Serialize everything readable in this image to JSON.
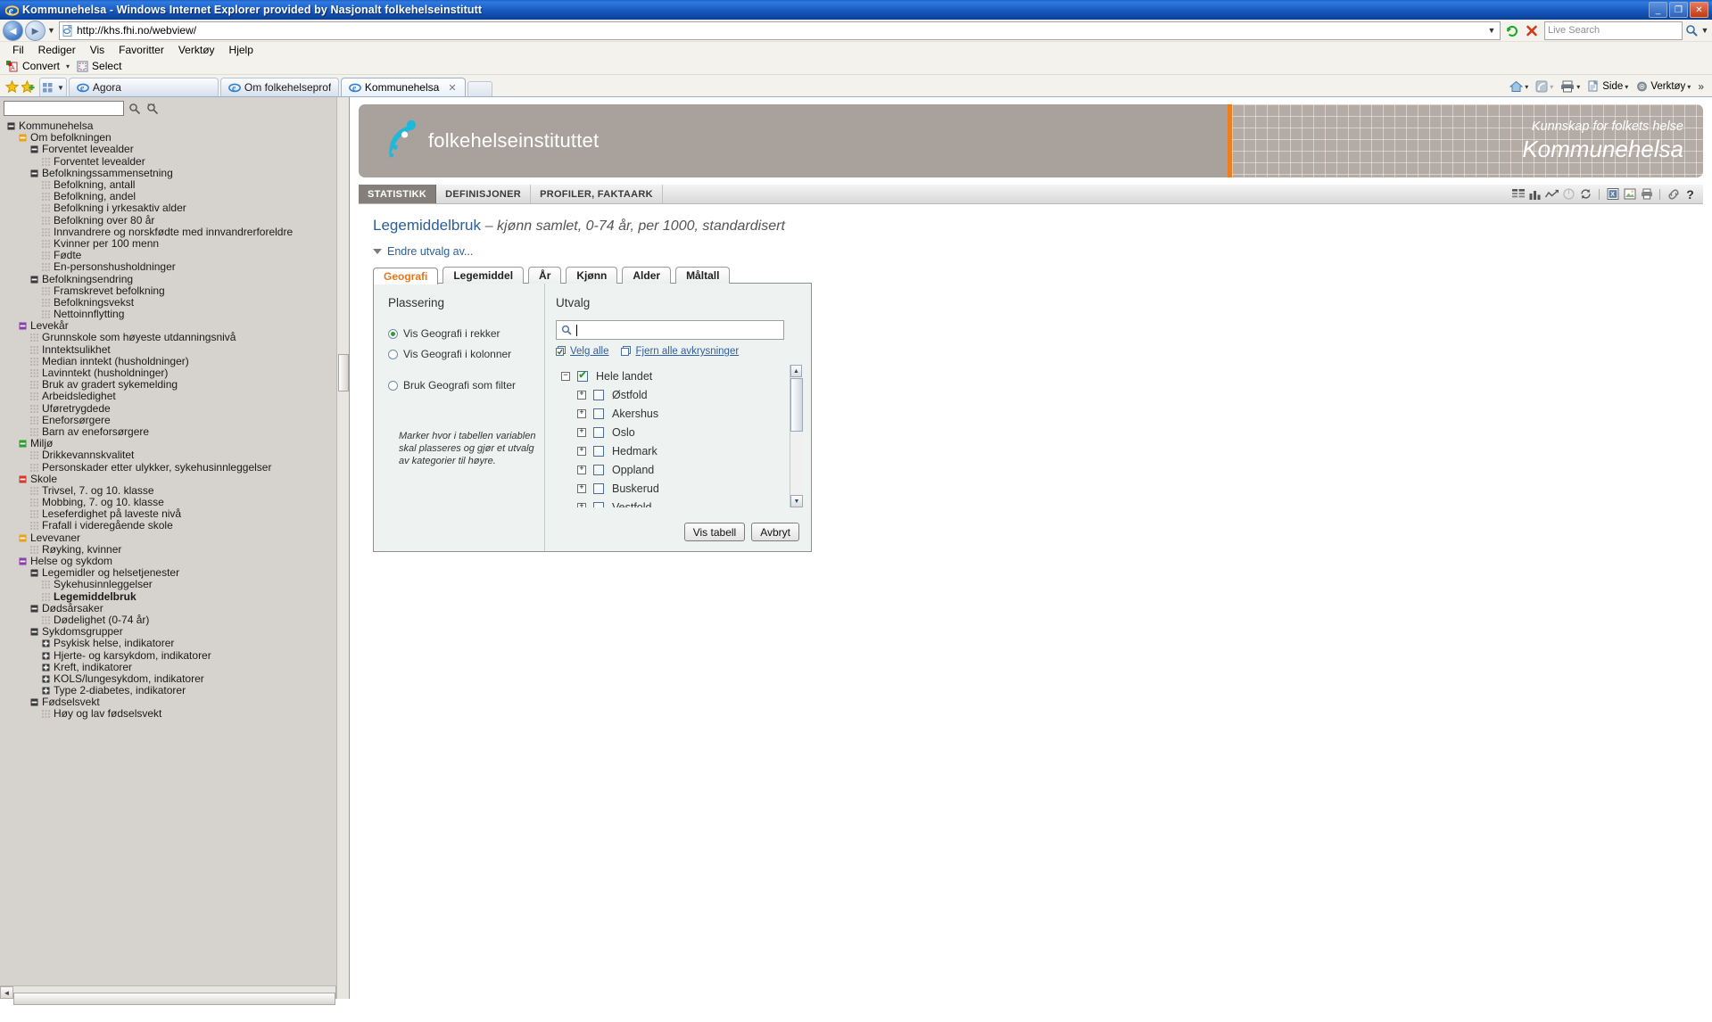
{
  "window": {
    "title": "Kommunehelsa - Windows Internet Explorer provided by Nasjonalt folkehelseinstitutt",
    "minimize": "_",
    "maximize": "❐",
    "close": "✕"
  },
  "address": {
    "url": "http://khs.fhi.no/webview/",
    "search_placeholder": "Live Search",
    "dropdown": "▼",
    "refresh": "↻",
    "stop": "✕"
  },
  "menu": {
    "items": [
      "Fil",
      "Rediger",
      "Vis",
      "Favoritter",
      "Verktøy",
      "Hjelp"
    ]
  },
  "command_bar": {
    "convert": "Convert",
    "convert_caret": "▾",
    "select": "Select"
  },
  "tabs": {
    "items": [
      {
        "label": "Agora",
        "active": false
      },
      {
        "label": "Om folkehelseprofilane og Ko...",
        "active": false
      },
      {
        "label": "Kommunehelsa",
        "active": true,
        "close": "✕"
      }
    ],
    "right_tools": [
      {
        "label": "",
        "name": "home-icon",
        "caret": "▾"
      },
      {
        "label": "",
        "name": "feeds-icon",
        "caret": "▾"
      },
      {
        "label": "",
        "name": "print-icon",
        "caret": "▾"
      },
      {
        "label": "Side",
        "name": "page-menu",
        "caret": "▾"
      },
      {
        "label": "Verktøy",
        "name": "tools-menu",
        "caret": "▾"
      },
      {
        "label": "»",
        "name": "overflow-chevron",
        "caret": ""
      }
    ]
  },
  "banner": {
    "logo_text": "folkehelseinstituttet",
    "tagline": "Kunnskap for folkets helse",
    "product": "Kommunehelsa"
  },
  "nav": {
    "tabs": [
      {
        "label": "STATISTIKK",
        "active": true
      },
      {
        "label": "DEFINISJONER",
        "active": false
      },
      {
        "label": "PROFILER, FAKTAARK",
        "active": false
      }
    ],
    "icons": [
      "table-icon",
      "bar-chart-icon",
      "line-chart-icon",
      "pie-chart-icon",
      "refresh-icon",
      "excel-export-icon",
      "image-export-icon",
      "print-icon",
      "link-icon",
      "help-icon"
    ]
  },
  "page": {
    "title_main": "Legemiddelbruk",
    "title_sub": "– kjønn samlet, 0-74 år, per 1000, standardisert",
    "change_selection": "Endre utvalg av..."
  },
  "sidebar": {
    "search_value": "",
    "tree": [
      {
        "label": "Kommunehelsa",
        "indent": 0,
        "mark": "minus",
        "markColor": "#3a3a3a",
        "bold": false
      },
      {
        "label": "Om befolkningen",
        "indent": 1,
        "mark": "minus",
        "markColor": "#e8a11a",
        "bold": false
      },
      {
        "label": "Forventet levealder",
        "indent": 2,
        "mark": "minus",
        "markColor": "#3a3a3a",
        "bold": false
      },
      {
        "label": "Forventet levealder",
        "indent": 3,
        "mark": "leaf",
        "markColor": "",
        "bold": false
      },
      {
        "label": "Befolkningssammensetning",
        "indent": 2,
        "mark": "minus",
        "markColor": "#3a3a3a",
        "bold": false
      },
      {
        "label": "Befolkning, antall",
        "indent": 3,
        "mark": "leaf",
        "markColor": "",
        "bold": false
      },
      {
        "label": "Befolkning, andel",
        "indent": 3,
        "mark": "leaf",
        "markColor": "",
        "bold": false
      },
      {
        "label": "Befolkning i yrkesaktiv alder",
        "indent": 3,
        "mark": "leaf",
        "markColor": "",
        "bold": false
      },
      {
        "label": "Befolkning over 80 år",
        "indent": 3,
        "mark": "leaf",
        "markColor": "",
        "bold": false
      },
      {
        "label": "Innvandrere og norskfødte med innvandrerforeldre",
        "indent": 3,
        "mark": "leaf",
        "markColor": "",
        "bold": false
      },
      {
        "label": "Kvinner per 100 menn",
        "indent": 3,
        "mark": "leaf",
        "markColor": "",
        "bold": false
      },
      {
        "label": "Fødte",
        "indent": 3,
        "mark": "leaf",
        "markColor": "",
        "bold": false
      },
      {
        "label": "En-personshusholdninger",
        "indent": 3,
        "mark": "leaf",
        "markColor": "",
        "bold": false
      },
      {
        "label": "Befolkningsendring",
        "indent": 2,
        "mark": "minus",
        "markColor": "#3a3a3a",
        "bold": false
      },
      {
        "label": "Framskrevet befolkning",
        "indent": 3,
        "mark": "leaf",
        "markColor": "",
        "bold": false
      },
      {
        "label": "Befolkningsvekst",
        "indent": 3,
        "mark": "leaf",
        "markColor": "",
        "bold": false
      },
      {
        "label": "Nettoinnflytting",
        "indent": 3,
        "mark": "leaf",
        "markColor": "",
        "bold": false
      },
      {
        "label": "Levekår",
        "indent": 1,
        "mark": "minus",
        "markColor": "#8b3fae",
        "bold": false
      },
      {
        "label": "Grunnskole som høyeste utdanningsnivå",
        "indent": 2,
        "mark": "leaf",
        "markColor": "",
        "bold": false
      },
      {
        "label": "Inntektsulikhet",
        "indent": 2,
        "mark": "leaf",
        "markColor": "",
        "bold": false
      },
      {
        "label": "Median inntekt (husholdninger)",
        "indent": 2,
        "mark": "leaf",
        "markColor": "",
        "bold": false
      },
      {
        "label": "Lavinntekt (husholdninger)",
        "indent": 2,
        "mark": "leaf",
        "markColor": "",
        "bold": false
      },
      {
        "label": "Bruk av gradert sykemelding",
        "indent": 2,
        "mark": "leaf",
        "markColor": "",
        "bold": false
      },
      {
        "label": "Arbeidsledighet",
        "indent": 2,
        "mark": "leaf",
        "markColor": "",
        "bold": false
      },
      {
        "label": "Uføretrygdede",
        "indent": 2,
        "mark": "leaf",
        "markColor": "",
        "bold": false
      },
      {
        "label": "Eneforsørgere",
        "indent": 2,
        "mark": "leaf",
        "markColor": "",
        "bold": false
      },
      {
        "label": "Barn av eneforsørgere",
        "indent": 2,
        "mark": "leaf",
        "markColor": "",
        "bold": false
      },
      {
        "label": "Miljø",
        "indent": 1,
        "mark": "minus",
        "markColor": "#2f9e2f",
        "bold": false
      },
      {
        "label": "Drikkevannskvalitet",
        "indent": 2,
        "mark": "leaf",
        "markColor": "",
        "bold": false
      },
      {
        "label": "Personskader etter ulykker, sykehusinnleggelser",
        "indent": 2,
        "mark": "leaf",
        "markColor": "",
        "bold": false
      },
      {
        "label": "Skole",
        "indent": 1,
        "mark": "minus",
        "markColor": "#d33a2c",
        "bold": false
      },
      {
        "label": "Trivsel, 7. og 10. klasse",
        "indent": 2,
        "mark": "leaf",
        "markColor": "",
        "bold": false
      },
      {
        "label": "Mobbing, 7. og 10. klasse",
        "indent": 2,
        "mark": "leaf",
        "markColor": "",
        "bold": false
      },
      {
        "label": "Leseferdighet på laveste nivå",
        "indent": 2,
        "mark": "leaf",
        "markColor": "",
        "bold": false
      },
      {
        "label": "Frafall i videregående skole",
        "indent": 2,
        "mark": "leaf",
        "markColor": "",
        "bold": false
      },
      {
        "label": "Levevaner",
        "indent": 1,
        "mark": "minus",
        "markColor": "#e8a11a",
        "bold": false
      },
      {
        "label": "Røyking, kvinner",
        "indent": 2,
        "mark": "leaf",
        "markColor": "",
        "bold": false
      },
      {
        "label": "Helse og sykdom",
        "indent": 1,
        "mark": "minus",
        "markColor": "#8b3fae",
        "bold": false
      },
      {
        "label": "Legemidler og helsetjenester",
        "indent": 2,
        "mark": "minus",
        "markColor": "#3a3a3a",
        "bold": false
      },
      {
        "label": "Sykehusinnleggelser",
        "indent": 3,
        "mark": "leaf",
        "markColor": "",
        "bold": false
      },
      {
        "label": "Legemiddelbruk",
        "indent": 3,
        "mark": "leaf",
        "markColor": "",
        "bold": true
      },
      {
        "label": "Dødsårsaker",
        "indent": 2,
        "mark": "minus",
        "markColor": "#3a3a3a",
        "bold": false
      },
      {
        "label": "Dødelighet (0-74 år)",
        "indent": 3,
        "mark": "leaf",
        "markColor": "",
        "bold": false
      },
      {
        "label": "Sykdomsgrupper",
        "indent": 2,
        "mark": "minus",
        "markColor": "#3a3a3a",
        "bold": false
      },
      {
        "label": "Psykisk helse, indikatorer",
        "indent": 3,
        "mark": "plus",
        "markColor": "#3a3a3a",
        "bold": false
      },
      {
        "label": "Hjerte- og karsykdom, indikatorer",
        "indent": 3,
        "mark": "plus",
        "markColor": "#3a3a3a",
        "bold": false
      },
      {
        "label": "Kreft, indikatorer",
        "indent": 3,
        "mark": "plus",
        "markColor": "#3a3a3a",
        "bold": false
      },
      {
        "label": "KOLS/lungesykdom, indikatorer",
        "indent": 3,
        "mark": "plus",
        "markColor": "#3a3a3a",
        "bold": false
      },
      {
        "label": "Type 2-diabetes, indikatorer",
        "indent": 3,
        "mark": "plus",
        "markColor": "#3a3a3a",
        "bold": false
      },
      {
        "label": "Fødselsvekt",
        "indent": 2,
        "mark": "minus",
        "markColor": "#3a3a3a",
        "bold": false
      },
      {
        "label": "Høy og lav fødselsvekt",
        "indent": 3,
        "mark": "leaf",
        "markColor": "",
        "bold": false
      }
    ],
    "hscroll_left": "◄",
    "hscroll_right": "►"
  },
  "dialog": {
    "tabs": [
      {
        "label": "Geografi",
        "active": true
      },
      {
        "label": "Legemiddel",
        "active": false
      },
      {
        "label": "År",
        "active": false
      },
      {
        "label": "Kjønn",
        "active": false
      },
      {
        "label": "Alder",
        "active": false
      },
      {
        "label": "Måltall",
        "active": false
      }
    ],
    "placement": {
      "heading": "Plassering",
      "options": [
        {
          "label": "Vis Geografi i rekker",
          "selected": true
        },
        {
          "label": "Vis Geografi i kolonner",
          "selected": false
        },
        {
          "label": "Bruk Geografi som filter",
          "selected": false
        }
      ],
      "hint": "Marker hvor i tabellen variablen skal plasseres og gjør et utvalg av kategorier til høyre."
    },
    "selection": {
      "heading": "Utvalg",
      "search_value": "",
      "select_all": "Velg alle",
      "clear_all": "Fjern alle avkrysninger",
      "tree": [
        {
          "label": "Hele landet",
          "indent": 0,
          "expander": "minus",
          "checked": true
        },
        {
          "label": "Østfold",
          "indent": 1,
          "expander": "plus",
          "checked": false
        },
        {
          "label": "Akershus",
          "indent": 1,
          "expander": "plus",
          "checked": false
        },
        {
          "label": "Oslo",
          "indent": 1,
          "expander": "plus",
          "checked": false
        },
        {
          "label": "Hedmark",
          "indent": 1,
          "expander": "plus",
          "checked": false
        },
        {
          "label": "Oppland",
          "indent": 1,
          "expander": "plus",
          "checked": false
        },
        {
          "label": "Buskerud",
          "indent": 1,
          "expander": "plus",
          "checked": false
        },
        {
          "label": "Vestfold",
          "indent": 1,
          "expander": "plus",
          "checked": false
        }
      ],
      "scroll_up": "▲",
      "scroll_down": "▼"
    },
    "buttons": {
      "show_table": "Vis tabell",
      "cancel": "Avbryt"
    }
  }
}
